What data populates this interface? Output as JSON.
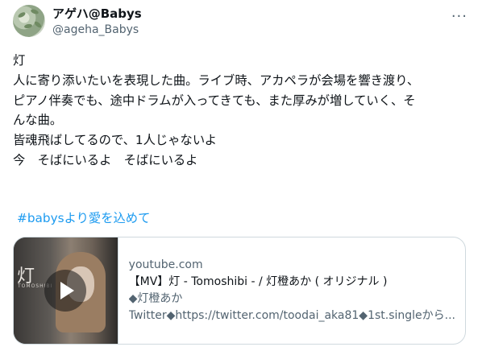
{
  "author": {
    "display_name": "アゲハ@Babys",
    "handle": "@ageha_Babys"
  },
  "icons": {
    "more": "more-horizontal-icon",
    "play": "play-icon"
  },
  "tweet": {
    "lines": [
      "灯",
      "人に寄り添いたいを表現した曲。ライブ時、アカペラが会場を響き渡り、",
      "ピアノ伴奏でも、途中ドラムが入ってきても、また厚みが増していく、そ",
      "んな曲。",
      "",
      "皆魂飛ばしてるので、1人じゃないよ",
      "今　そばにいるよ　そばにいるよ"
    ],
    "hashtag": "#babysより愛を込めて"
  },
  "card": {
    "thumbnail_kanji": "灯",
    "thumbnail_sub": "TOMOSHIBI",
    "domain": "youtube.com",
    "title": "【MV】灯 - Tomoshibi - / 灯橙あか ( オリジナル )",
    "line1": "◆灯橙あか",
    "line2": "Twitter◆https://twitter.com/toodai_aka81◆1st.singleから..."
  },
  "colors": {
    "link": "#1d9bf0",
    "secondary_text": "#536471",
    "border": "#cfd9de"
  }
}
